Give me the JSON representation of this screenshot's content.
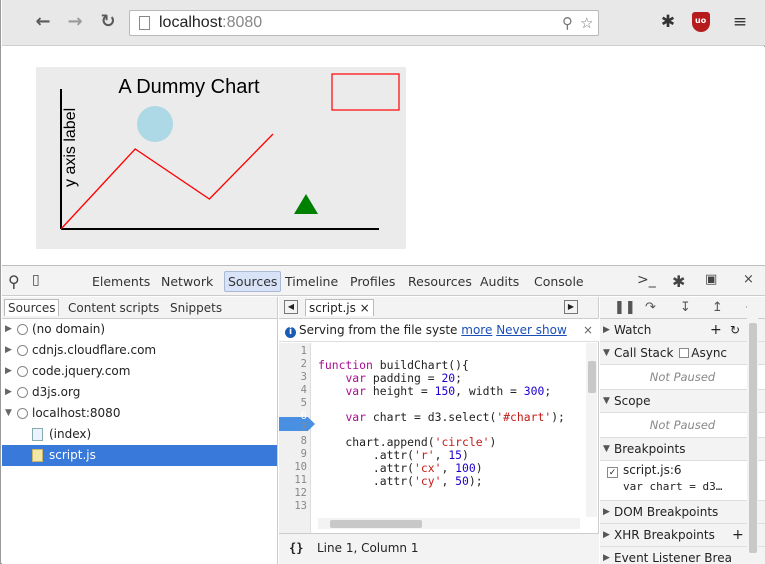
{
  "browser": {
    "url_host": "localhost",
    "url_port": ":8080",
    "nav_icons": [
      "back-icon",
      "forward-icon",
      "reload-icon"
    ],
    "omni_icons": [
      "zoom-icon",
      "star-icon"
    ],
    "extensions": [
      "puzzle-icon",
      "ublock-icon",
      "menu-icon"
    ]
  },
  "chart_data": {
    "type": "line",
    "title": "A Dummy Chart",
    "ylabel": "y axis label",
    "xlabel": "",
    "series": [
      {
        "x": [
          0,
          70,
          140,
          200
        ],
        "y": [
          0,
          80,
          30,
          95
        ],
        "color": "#ff0000"
      }
    ],
    "circle": {
      "color": "#add8e6"
    },
    "triangle": {
      "color": "#008000"
    },
    "rect": {
      "color": "#ff0000"
    },
    "ylim": [
      0,
      150
    ],
    "xlim": [
      0,
      300
    ],
    "grid": false
  },
  "devtools": {
    "tabs": [
      "Elements",
      "Network",
      "Sources",
      "Timeline",
      "Profiles",
      "Resources",
      "Audits",
      "Console"
    ],
    "active_tab": "Sources",
    "sources_subtabs": [
      "Sources",
      "Content scripts",
      "Snippets"
    ],
    "tree": [
      {
        "label": "(no domain)"
      },
      {
        "label": "cdnjs.cloudflare.com"
      },
      {
        "label": "code.jquery.com"
      },
      {
        "label": "d3js.org"
      },
      {
        "label": "localhost:8080"
      },
      {
        "label": "(index)"
      },
      {
        "label": "script.js"
      }
    ],
    "open_file": "script.js",
    "infobar_text": "Serving from the file syste",
    "infobar_more": "more",
    "infobar_never": "Never show",
    "code_lines": [
      {
        "n": "1",
        "t": ""
      },
      {
        "n": "2",
        "t": "function buildChart(){"
      },
      {
        "n": "3",
        "t": "    var padding = 20;"
      },
      {
        "n": "4",
        "t": "    var height = 150, width = 300;"
      },
      {
        "n": "5",
        "t": ""
      },
      {
        "n": "6",
        "t": "    var chart = d3.select('#chart');"
      },
      {
        "n": "7",
        "t": ""
      },
      {
        "n": "8",
        "t": "    chart.append('circle')"
      },
      {
        "n": "9",
        "t": "        .attr('r', 15)"
      },
      {
        "n": "10",
        "t": "        .attr('cx', 100)"
      },
      {
        "n": "11",
        "t": "        .attr('cy', 50);"
      },
      {
        "n": "12",
        "t": ""
      },
      {
        "n": "13",
        "t": ""
      }
    ],
    "cursor_status": "Line 1, Column 1",
    "pretty_print": "{}",
    "right": {
      "watch": "Watch",
      "call_stack": "Call Stack",
      "async": "Async",
      "not_paused": "Not Paused",
      "scope": "Scope",
      "breakpoints": "Breakpoints",
      "bp_file": "script.js:6",
      "bp_code": "var chart = d3…",
      "dom_bp": "DOM Breakpoints",
      "xhr_bp": "XHR Breakpoints",
      "event_bp": "Event Listener Brea"
    }
  }
}
